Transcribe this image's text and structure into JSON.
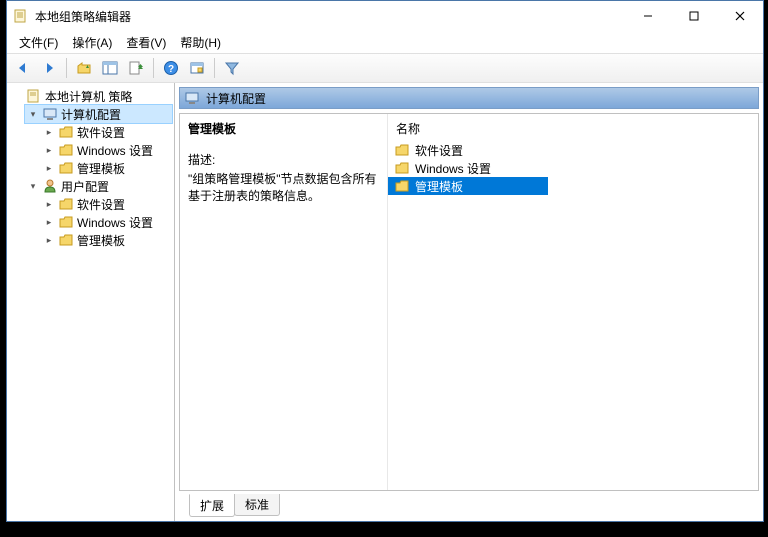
{
  "window": {
    "title": "本地组策略编辑器"
  },
  "menu": {
    "file": "文件(F)",
    "action": "操作(A)",
    "view": "查看(V)",
    "help": "帮助(H)"
  },
  "tree": {
    "root": "本地计算机 策略",
    "computer_config": "计算机配置",
    "user_config": "用户配置",
    "software_settings": "软件设置",
    "windows_settings": "Windows 设置",
    "admin_templates": "管理模板"
  },
  "detail": {
    "header": "计算机配置",
    "heading": "管理模板",
    "desc_label": "描述:",
    "desc_text": "\"组策略管理模板\"节点数据包含所有基于注册表的策略信息。",
    "col_name": "名称",
    "items": {
      "software_settings": "软件设置",
      "windows_settings": "Windows 设置",
      "admin_templates": "管理模板"
    }
  },
  "tabs": {
    "extended": "扩展",
    "standard": "标准"
  }
}
